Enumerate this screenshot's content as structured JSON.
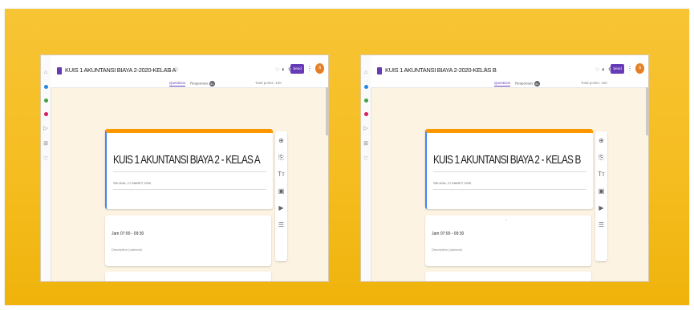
{
  "screens": [
    {
      "doc_title": "KUIS 1 AKUNTANSI BIAYA 2-2020-KELAS A",
      "form_title": "KUIS 1 AKUNTANSI BIAYA 2 - KELAS A",
      "form_date": "SELASA, 17 MARET 2020"
    },
    {
      "doc_title": "KUIS 1 AKUNTANSI BIAYA 2-2020-KELAS B",
      "form_title": "KUIS 1 AKUNTANSI BIAYA 2 - KELAS B",
      "form_date": "SELASA, 17 MARET 2020"
    }
  ],
  "tabs": {
    "questions": "Questions",
    "responses": "Responses",
    "responses_count": "31"
  },
  "total_points": "Total points: 100",
  "send_label": "Send",
  "avatar_initial": "S",
  "section": {
    "title": "Jam 07:00 - 09:30",
    "description": "Description (optional)"
  },
  "icons": {
    "title_bar": [
      "folder-icon",
      "star-icon"
    ],
    "toolbar": [
      "palette-icon",
      "eye-icon",
      "settings-icon"
    ],
    "more": "more-vert-icon",
    "fab": [
      "add-question-icon",
      "import-icon",
      "add-title-icon",
      "add-image-icon",
      "add-video-icon",
      "add-section-icon"
    ]
  },
  "colors": {
    "background": "#f5bd20",
    "accent": "#673ab7",
    "header_band": "#ff9800",
    "avatar": "#e67e22"
  }
}
